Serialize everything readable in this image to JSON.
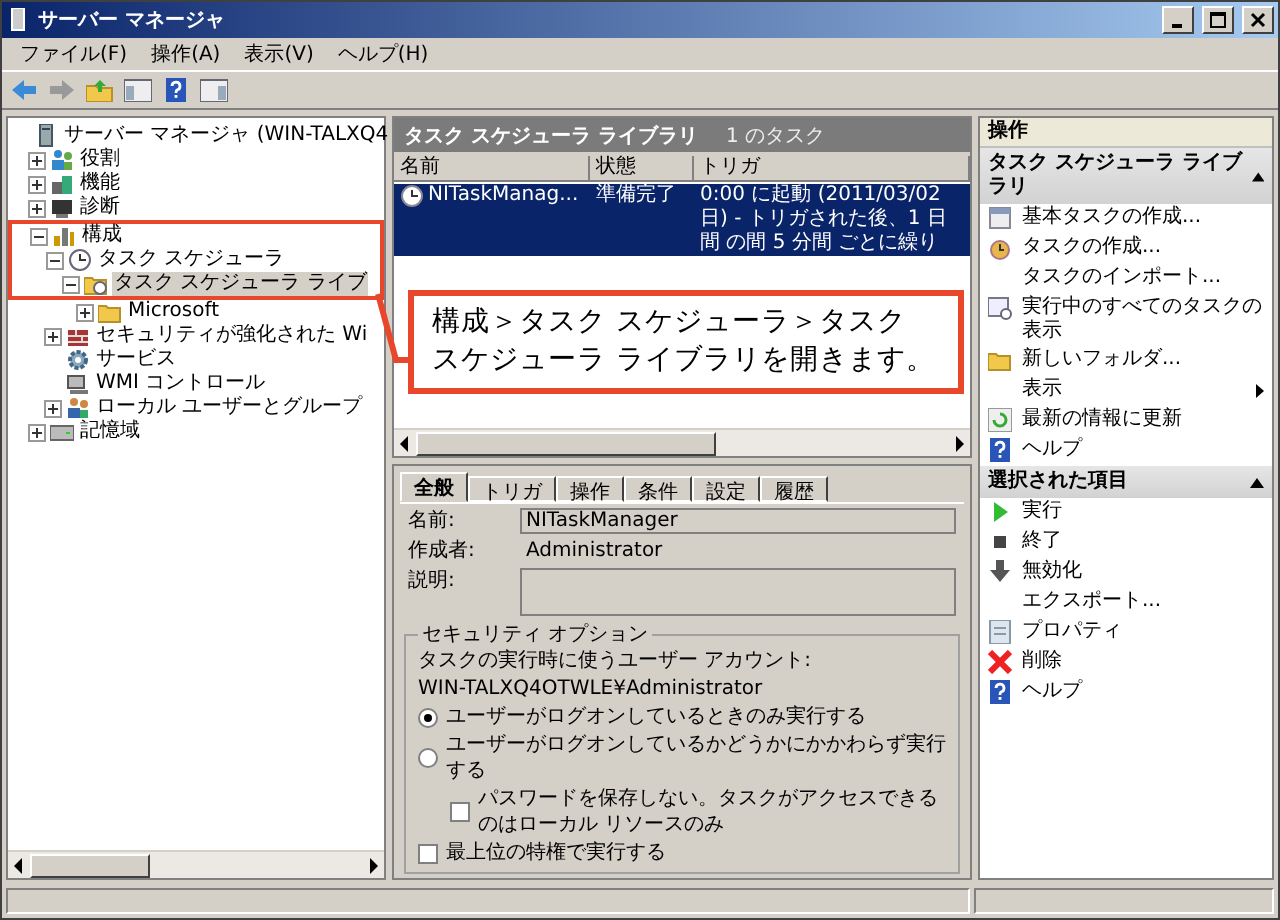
{
  "window": {
    "title": "サーバー マネージャ"
  },
  "menu": [
    "ファイル(F)",
    "操作(A)",
    "表示(V)",
    "ヘルプ(H)"
  ],
  "toolbar": [
    {
      "kind": "back"
    },
    {
      "kind": "forward"
    },
    {
      "kind": "up"
    },
    {
      "kind": "pane"
    },
    {
      "kind": "help"
    },
    {
      "kind": "pane2"
    }
  ],
  "tree": [
    {
      "label": "サーバー マネージャ (WIN-TALXQ4",
      "kind": "server",
      "selected": false,
      "highlighted": false,
      "children": [
        {
          "label": "役割",
          "kind": "roles",
          "expanded": false,
          "selected": false,
          "highlighted": false
        },
        {
          "label": "機能",
          "kind": "features",
          "expanded": false,
          "selected": false,
          "highlighted": false
        },
        {
          "label": "診断",
          "kind": "diagnostics",
          "expanded": false,
          "selected": false,
          "highlighted": false
        },
        {
          "label": "構成",
          "kind": "configuration",
          "expanded": true,
          "selected": false,
          "highlighted": true,
          "children": [
            {
              "label": "タスク スケジューラ",
              "kind": "clock",
              "expanded": true,
              "selected": false,
              "highlighted": true,
              "children": [
                {
                  "label": "タスク スケジューラ ライブ",
                  "kind": "folder-clock",
                  "expanded": true,
                  "selected": true,
                  "highlighted": true,
                  "children": [
                    {
                      "label": "Microsoft",
                      "kind": "folder",
                      "expanded": false,
                      "selected": false,
                      "highlighted": false
                    }
                  ]
                }
              ]
            },
            {
              "label": "セキュリティが強化された Wi",
              "kind": "security",
              "expanded": false,
              "selected": false,
              "highlighted": false
            },
            {
              "label": "サービス",
              "kind": "services",
              "selected": false,
              "highlighted": false
            },
            {
              "label": "WMI コントロール",
              "kind": "wmi",
              "selected": false,
              "highlighted": false
            },
            {
              "label": "ローカル ユーザーとグループ",
              "kind": "users",
              "expanded": false,
              "selected": false,
              "highlighted": false
            }
          ]
        },
        {
          "label": "記憶域",
          "kind": "storage",
          "expanded": false,
          "selected": false,
          "highlighted": false
        }
      ]
    }
  ],
  "list_header": {
    "title": "タスク スケジューラ ライブラリ",
    "count": "1 のタスク"
  },
  "task_table": {
    "columns": [
      "名前",
      "状態",
      "トリガ"
    ],
    "rows": [
      {
        "cells": [
          "NITaskManag...",
          "準備完了",
          "0:00 に起動 (2011/03/02 日) - トリガされた後、1 日間 の間 5 分間 ごとに繰り"
        ],
        "selected": true
      }
    ]
  },
  "callout": {
    "lines": [
      "構成＞タスク スケジューラ＞タスク",
      "スケジューラ ライブラリを開きます。"
    ]
  },
  "detail": {
    "tabs": [
      {
        "label": "全般",
        "selected": true
      },
      {
        "label": "トリガ",
        "selected": false
      },
      {
        "label": "操作",
        "selected": false
      },
      {
        "label": "条件",
        "selected": false
      },
      {
        "label": "設定",
        "selected": false
      },
      {
        "label": "履歴",
        "selected": false
      }
    ],
    "fields": [
      {
        "label": "名前:",
        "kind": "input",
        "value": "NITaskManager"
      },
      {
        "label": "作成者:",
        "kind": "text",
        "value": "Administrator"
      },
      {
        "label": "説明:",
        "kind": "textarea"
      }
    ],
    "security": {
      "legend": "セキュリティ オプション",
      "account_label": "タスクの実行時に使うユーザー アカウント:",
      "account": "WIN-TALXQ4OTWLE¥Administrator",
      "options": [
        {
          "kind": "radio",
          "label": "ユーザーがログオンしているときのみ実行する",
          "selected": true
        },
        {
          "kind": "radio",
          "label": "ユーザーがログオンしているかどうかにかかわらず実行する",
          "selected": false,
          "children": [
            {
              "kind": "checkbox",
              "label": "パスワードを保存しない。タスクがアクセスできるのはローカル リソースのみ",
              "checked": false
            }
          ]
        },
        {
          "kind": "checkbox",
          "label": "最上位の特権で実行する",
          "checked": false
        }
      ]
    }
  },
  "actions": {
    "title": "操作",
    "sections": [
      {
        "title": "タスク スケジューラ ライブラリ",
        "expanded": true,
        "items": [
          {
            "label": "基本タスクの作成...",
            "kind": "calendar",
            "submenu": false
          },
          {
            "label": "タスクの作成...",
            "kind": "clock",
            "submenu": false
          },
          {
            "label": "タスクのインポート...",
            "kind": "none",
            "submenu": false
          },
          {
            "label": "実行中のすべてのタスクの表示",
            "kind": "window",
            "submenu": false
          },
          {
            "label": "新しいフォルダ...",
            "kind": "folder",
            "submenu": false
          },
          {
            "label": "表示",
            "kind": "none",
            "submenu": true
          },
          {
            "label": "最新の情報に更新",
            "kind": "refresh",
            "submenu": false
          },
          {
            "label": "ヘルプ",
            "kind": "help",
            "submenu": false
          }
        ]
      },
      {
        "title": "選択された項目",
        "expanded": true,
        "items": [
          {
            "label": "実行",
            "kind": "run",
            "submenu": false
          },
          {
            "label": "終了",
            "kind": "stop",
            "submenu": false
          },
          {
            "label": "無効化",
            "kind": "disable",
            "submenu": false
          },
          {
            "label": "エクスポート...",
            "kind": "none",
            "submenu": false
          },
          {
            "label": "プロパティ",
            "kind": "properties",
            "submenu": false
          },
          {
            "label": "削除",
            "kind": "delete",
            "submenu": false
          },
          {
            "label": "ヘルプ",
            "kind": "help",
            "submenu": false
          }
        ]
      }
    ]
  }
}
